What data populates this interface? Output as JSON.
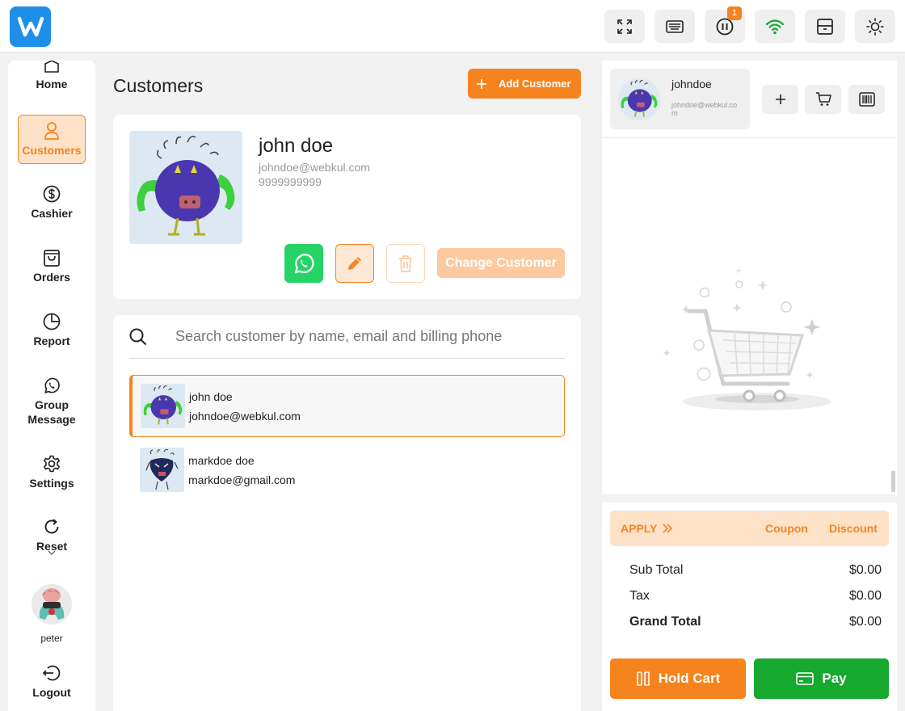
{
  "topbar": {
    "icons": [
      "fullscreen-icon",
      "keyboard-icon",
      "pause-icon",
      "wifi-icon",
      "drawer-icon",
      "sun-icon"
    ],
    "hold_badge": "1"
  },
  "sidebar": {
    "items": [
      {
        "label": "Home",
        "icon": "home-icon"
      },
      {
        "label": "Customers",
        "icon": "user-icon"
      },
      {
        "label": "Cashier",
        "icon": "dollar-icon"
      },
      {
        "label": "Orders",
        "icon": "bag-icon"
      },
      {
        "label": "Report",
        "icon": "pie-icon"
      },
      {
        "label": "Group Message",
        "icon": "whatsapp-icon"
      },
      {
        "label": "Settings",
        "icon": "gear-icon"
      },
      {
        "label": "Reset",
        "icon": "reset-icon"
      }
    ],
    "user_name": "peter",
    "logout_label": "Logout"
  },
  "main": {
    "title": "Customers",
    "add_customer_label": "Add Customer",
    "selected": {
      "name": "john doe",
      "email": "johndoe@webkul.com",
      "phone": "9999999999"
    },
    "change_customer_label": "Change Customer",
    "search_placeholder": "Search customer by name, email and billing phone",
    "customers": [
      {
        "name": "john doe",
        "email": "johndoe@webkul.com"
      },
      {
        "name": "markdoe doe",
        "email": "markdoe@gmail.com"
      }
    ]
  },
  "cart": {
    "customer_name": "johndoe",
    "customer_email": "johndoe@webkul.com",
    "apply_label": "APPLY",
    "coupon_label": "Coupon",
    "discount_label": "Discount",
    "subtotal_label": "Sub Total",
    "subtotal": "$0.00",
    "tax_label": "Tax",
    "tax": "$0.00",
    "grand_total_label": "Grand Total",
    "grand_total": "$0.00",
    "hold_label": "Hold Cart",
    "pay_label": "Pay"
  },
  "colors": {
    "accent": "#f5841f",
    "pay": "#16a82f",
    "whatsapp": "#25d366",
    "logo": "#1d8fe8"
  }
}
